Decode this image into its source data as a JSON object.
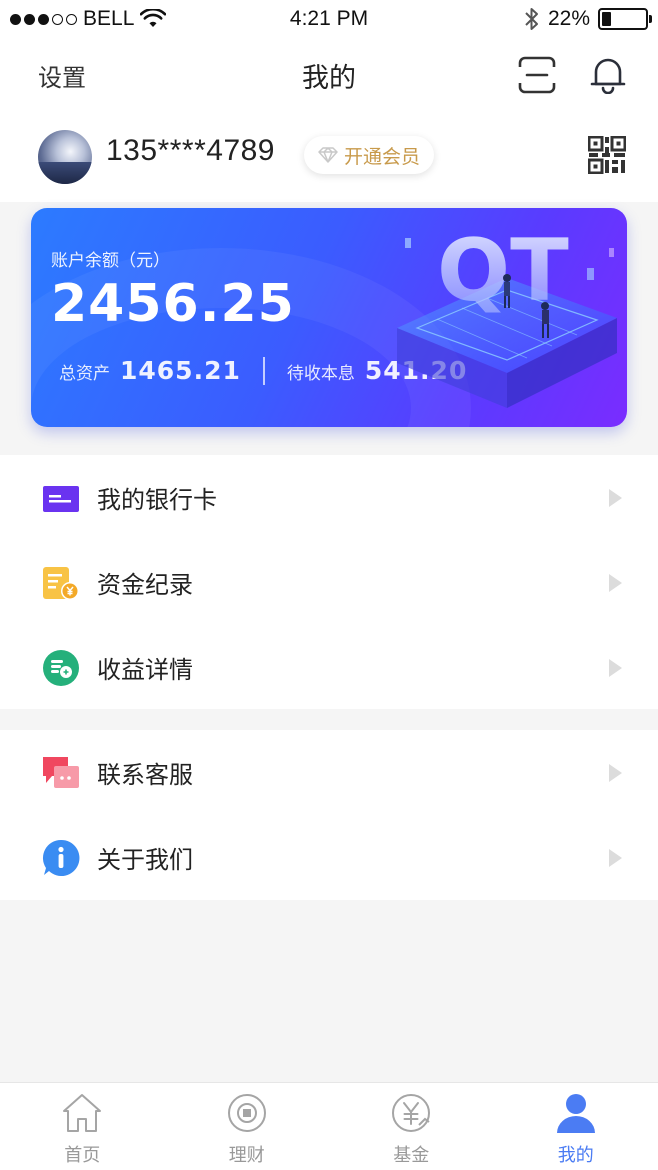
{
  "status_bar": {
    "carrier": "BELL",
    "time": "4:21 PM",
    "battery": "22%",
    "battery_level": 0.22
  },
  "nav": {
    "left": "设置",
    "title": "我的"
  },
  "profile": {
    "phone": "135****4789",
    "vip_label": "开通会员"
  },
  "card": {
    "balance_label": "账户余额（元）",
    "balance": "2456.25",
    "total_assets_label": "总资产",
    "total_assets": "1465.21",
    "pending_interest_label": "待收本息",
    "pending_interest": "541.20",
    "illustration_text": "QT"
  },
  "menu_group_1": [
    {
      "label": "我的银行卡",
      "icon": "bank-card-icon",
      "color": "#6a33f0"
    },
    {
      "label": "资金纪录",
      "icon": "fund-record-icon",
      "color": "#f8c345"
    },
    {
      "label": "收益详情",
      "icon": "income-detail-icon",
      "color": "#25b07b"
    }
  ],
  "menu_group_2": [
    {
      "label": "联系客服",
      "icon": "customer-service-icon",
      "color": "#f0475f"
    },
    {
      "label": "关于我们",
      "icon": "info-icon",
      "color": "#3a8cf2"
    }
  ],
  "tabs": [
    {
      "label": "首页",
      "icon": "home-icon",
      "active": false
    },
    {
      "label": "理财",
      "icon": "wealth-icon",
      "active": false
    },
    {
      "label": "基金",
      "icon": "fund-icon",
      "active": false
    },
    {
      "label": "我的",
      "icon": "user-icon",
      "active": true
    }
  ],
  "colors": {
    "accent": "#4b7cf3",
    "card_start": "#2c7bff",
    "card_end": "#7a2cff",
    "vip_gold": "#c89a4b",
    "page_bg": "#f5f5f5"
  }
}
